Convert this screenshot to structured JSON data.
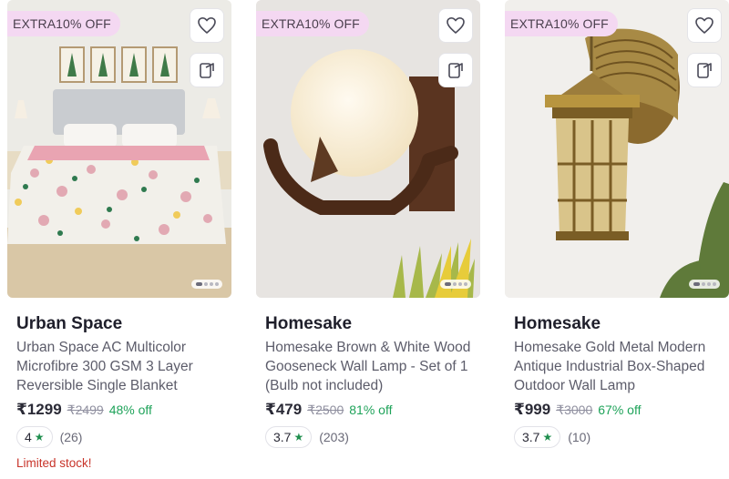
{
  "products": [
    {
      "badge": "EXTRA10% OFF",
      "brand": "Urban Space",
      "title": "Urban Space AC Multicolor Microfibre 300 GSM 3 Layer Reversible Single Blanket",
      "price": "₹1299",
      "mrp": "₹2499",
      "discount": "48% off",
      "rating": "4",
      "rating_count": "(26)",
      "stock_note": "Limited stock!",
      "image": "bedroom-blanket-photo"
    },
    {
      "badge": "EXTRA10% OFF",
      "brand": "Homesake",
      "title": "Homesake Brown & White Wood Gooseneck Wall Lamp - Set of 1 (Bulb not included)",
      "price": "₹479",
      "mrp": "₹2500",
      "discount": "81% off",
      "rating": "3.7",
      "rating_count": "(203)",
      "stock_note": "",
      "image": "wood-wall-lamp-photo"
    },
    {
      "badge": "EXTRA10% OFF",
      "brand": "Homesake",
      "title": "Homesake Gold Metal Modern Antique Industrial Box-Shaped Outdoor Wall Lamp",
      "price": "₹999",
      "mrp": "₹3000",
      "discount": "67% off",
      "rating": "3.7",
      "rating_count": "(10)",
      "stock_note": "",
      "image": "gold-lantern-lamp-photo"
    }
  ],
  "icons": {
    "wishlist": "heart-icon",
    "share": "share-icon",
    "rating": "star-icon"
  },
  "colors": {
    "badge_bg": "#f4d8f2",
    "discount": "#1fa35a",
    "rating_star": "#1f8f4e",
    "limited_stock": "#c8342a"
  }
}
